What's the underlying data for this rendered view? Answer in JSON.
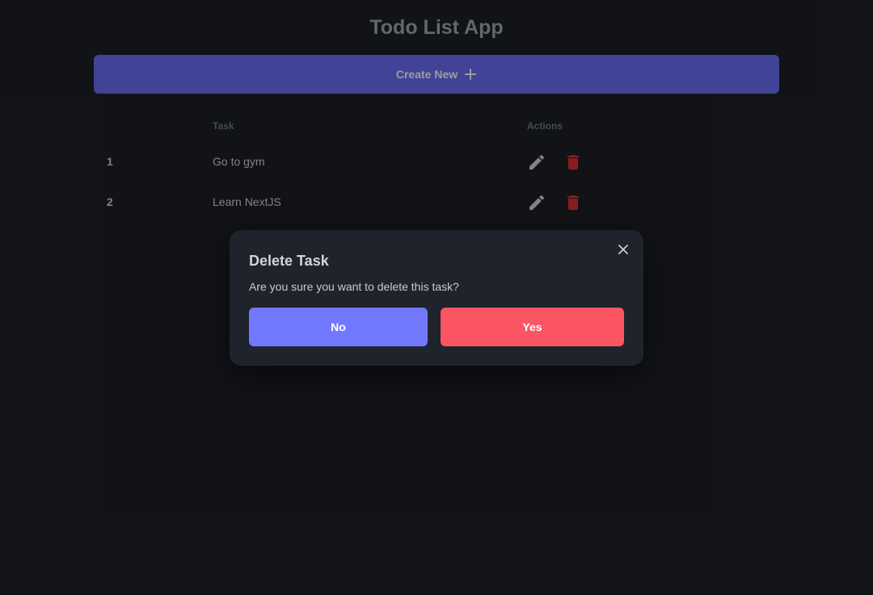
{
  "app": {
    "title": "Todo List App"
  },
  "toolbar": {
    "create_label": "Create New",
    "create_icon": "plus-icon"
  },
  "table": {
    "headers": {
      "index": "",
      "task": "Task",
      "actions": "Actions"
    },
    "rows": [
      {
        "num": "1",
        "task": "Go to gym"
      },
      {
        "num": "2",
        "task": "Learn NextJS"
      }
    ],
    "icons": {
      "edit": "pencil-icon",
      "delete": "trash-icon"
    }
  },
  "modal": {
    "title": "Delete Task",
    "message": "Are you sure you want to delete this task?",
    "no_label": "No",
    "yes_label": "Yes",
    "close_icon": "close-icon"
  },
  "colors": {
    "background": "#121418",
    "primary": "#6366f1",
    "modal_bg": "#1f232b",
    "no_button": "#7278fd",
    "yes_button": "#fb5563",
    "delete_icon": "#dc2626"
  }
}
